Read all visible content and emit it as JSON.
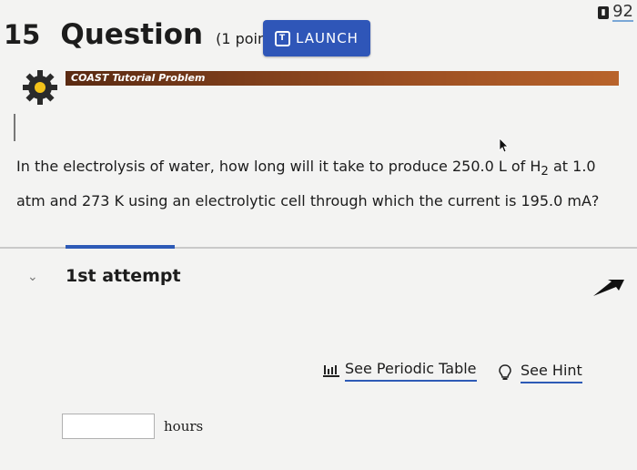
{
  "corner": {
    "number": "92"
  },
  "question": {
    "number": "15",
    "word": "Question",
    "points": "(1 point)"
  },
  "launch": {
    "label": "LAUNCH",
    "icon": "launch-icon"
  },
  "banner": {
    "label": "COAST Tutorial Problem",
    "icon": "gear-icon"
  },
  "problem": {
    "text_before": "In the electrolysis of water, how long will it take to produce 250.0 L of H",
    "subscript": "2",
    "text_after": " at 1.0 atm and 273 K using an electrolytic cell through which the current is 195.0 mA?"
  },
  "attempt": {
    "label": "1st attempt"
  },
  "links": {
    "periodic_table": "See Periodic Table",
    "hint": "See Hint"
  },
  "answer": {
    "value": "",
    "unit": "hours"
  },
  "colors": {
    "accent": "#2d5ab6",
    "banner": "#9a4e22"
  }
}
